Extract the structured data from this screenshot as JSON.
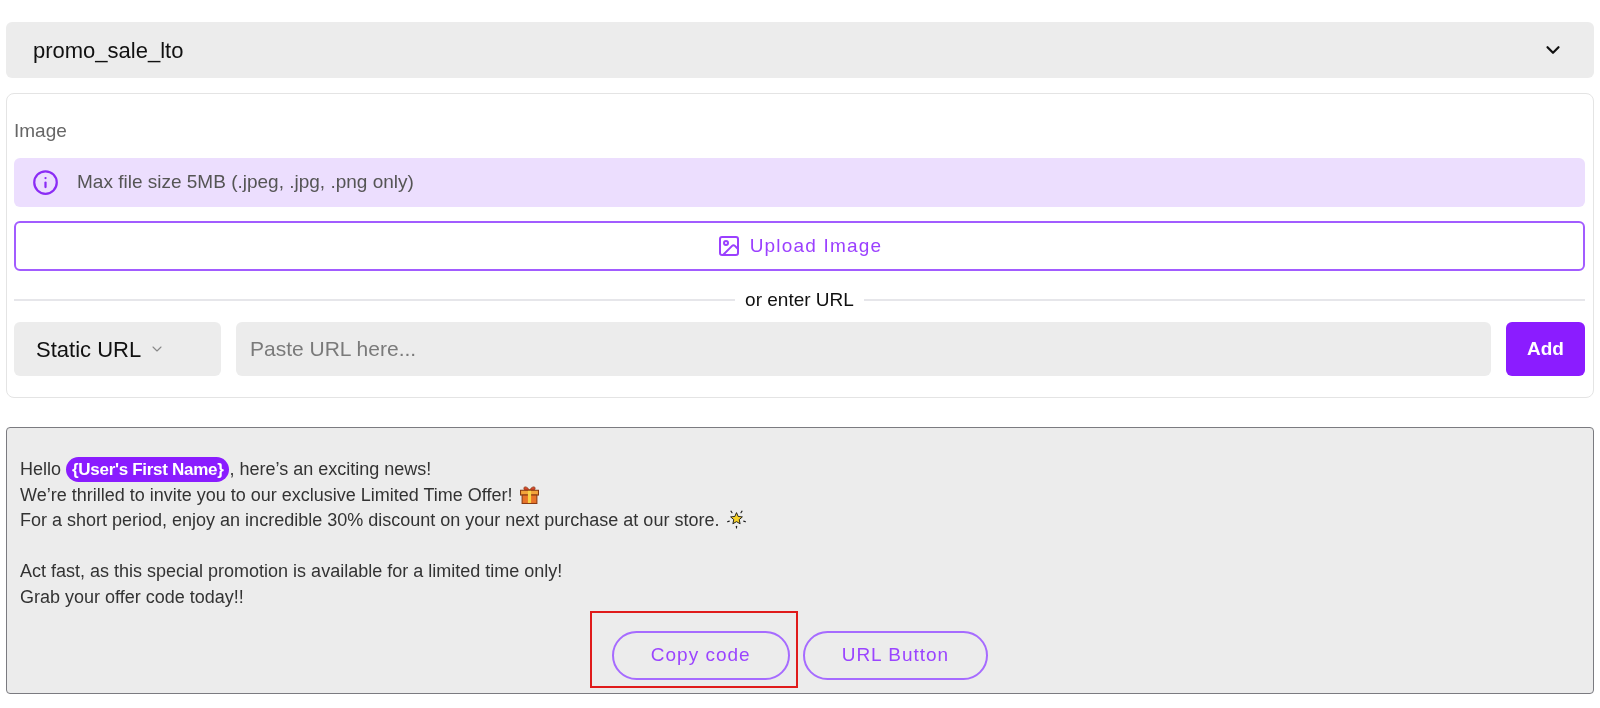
{
  "template_select": {
    "value": "promo_sale_lto"
  },
  "image_section": {
    "label": "Image",
    "info": "Max file size 5MB (.jpeg, .jpg, .png only)",
    "upload_button": "Upload Image",
    "divider_text": "or enter URL",
    "url_type": {
      "value": "Static URL"
    },
    "url_input": {
      "placeholder": "Paste URL here..."
    },
    "add_button": "Add"
  },
  "message": {
    "paragraphs": [
      {
        "lines": [
          {
            "segments": [
              {
                "kind": "text",
                "text": "Hello"
              },
              {
                "kind": "variable",
                "text": "{User's First Name}"
              },
              {
                "kind": "text",
                "text": ", here’s an exciting news!"
              }
            ]
          },
          {
            "segments": [
              {
                "kind": "text",
                "text": "We’re thrilled to invite you to our exclusive Limited Time Offer!"
              },
              {
                "kind": "gift"
              }
            ]
          },
          {
            "segments": [
              {
                "kind": "text",
                "text": "For a short period, enjoy an incredible 30% discount on your next purchase at our store."
              },
              {
                "kind": "burst"
              }
            ]
          }
        ]
      },
      {
        "lines": [
          {
            "segments": [
              {
                "kind": "text",
                "text": "Act fast, as this special promotion is available for a limited time only!"
              }
            ]
          },
          {
            "segments": [
              {
                "kind": "text",
                "text": "Grab your offer code today!!"
              }
            ]
          }
        ]
      }
    ]
  },
  "buttons": [
    {
      "label": "Copy code",
      "highlighted": true
    },
    {
      "label": "URL Button",
      "highlighted": false
    }
  ]
}
